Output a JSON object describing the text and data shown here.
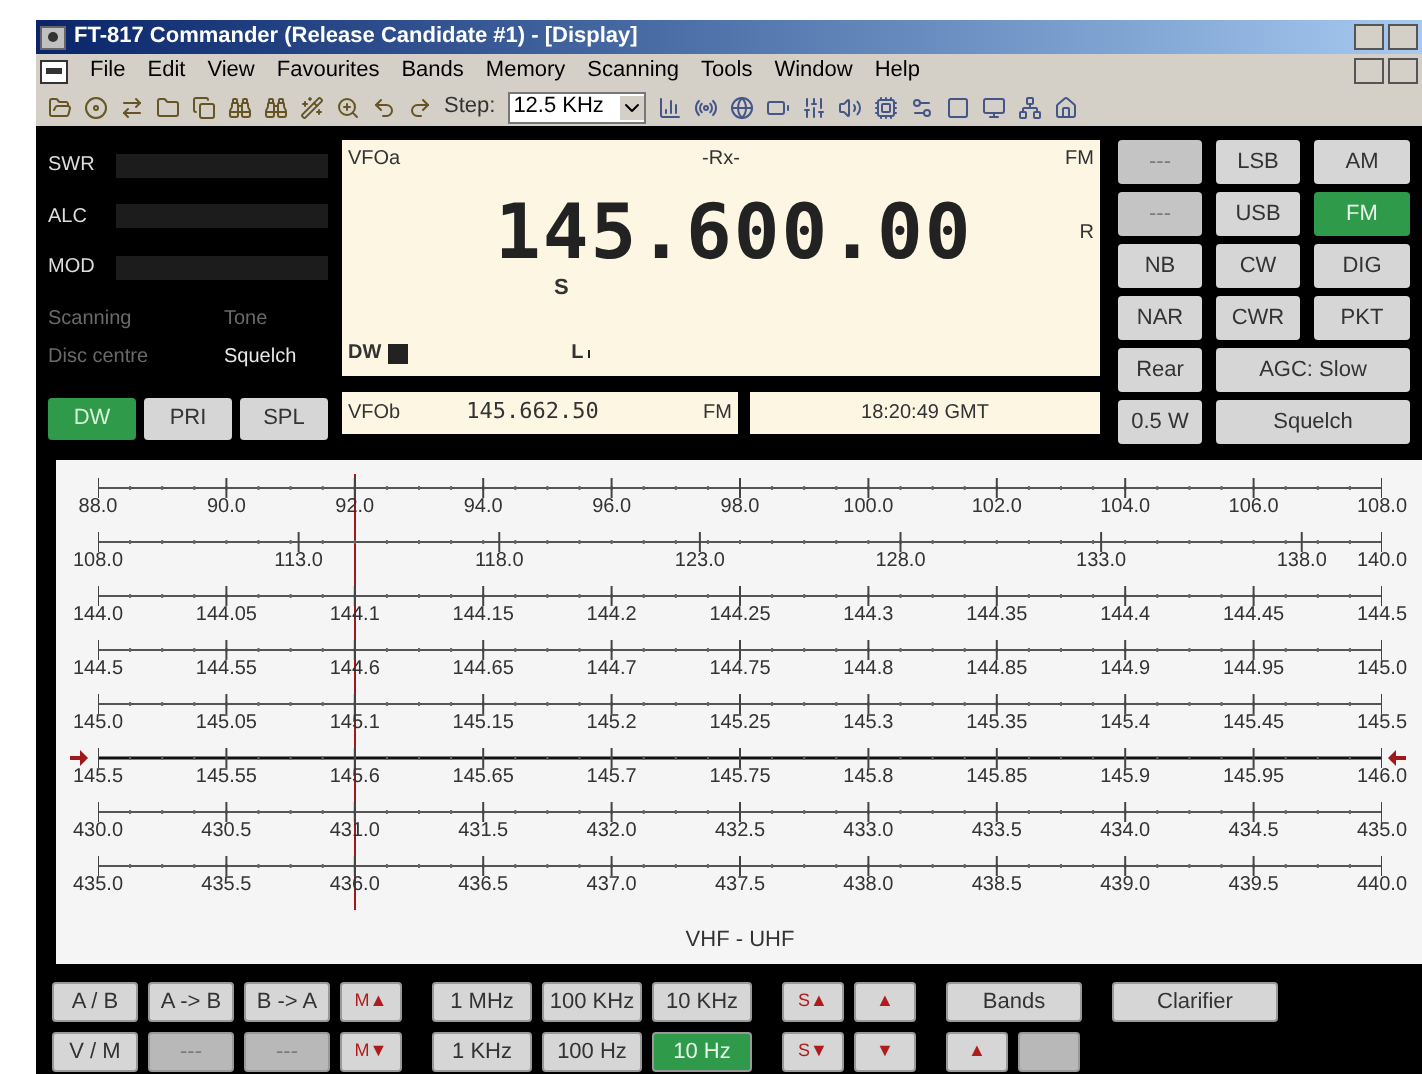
{
  "window": {
    "title": "FT-817 Commander (Release Candidate #1) - [Display]"
  },
  "menu": [
    {
      "label": "File"
    },
    {
      "label": "Edit"
    },
    {
      "label": "View"
    },
    {
      "label": "Favourites"
    },
    {
      "label": "Bands"
    },
    {
      "label": "Memory"
    },
    {
      "label": "Scanning"
    },
    {
      "label": "Tools"
    },
    {
      "label": "Window"
    },
    {
      "label": "Help"
    }
  ],
  "toolbar": {
    "step_label": "Step:",
    "step_value": "12.5 KHz"
  },
  "meters": [
    {
      "label": "SWR",
      "level": 0
    },
    {
      "label": "ALC",
      "level": 0
    },
    {
      "label": "MOD",
      "level": 0
    }
  ],
  "indicators": [
    {
      "label": "Scanning",
      "active": false
    },
    {
      "label": "Tone",
      "active": false
    },
    {
      "label": "Disc centre",
      "active": false
    },
    {
      "label": "Squelch",
      "active": true
    }
  ],
  "left_buttons": [
    {
      "label": "DW",
      "on": true
    },
    {
      "label": "PRI",
      "on": false
    },
    {
      "label": "SPL",
      "on": false
    }
  ],
  "display": {
    "vfo": "VFOa",
    "status": "-Rx-",
    "mode": "FM",
    "frequency": "145.600.00",
    "s_label": "S",
    "r_label": "R",
    "dw_label": "DW",
    "l_label": "L"
  },
  "vfo_b": {
    "name": "VFOb",
    "frequency": "145.662.50",
    "mode": "FM"
  },
  "clock": "18:20:49 GMT",
  "mode_buttons": [
    {
      "label": "---",
      "kind": "normal",
      "on": false,
      "disabled": true
    },
    {
      "label": "LSB",
      "kind": "normal",
      "on": false,
      "disabled": false
    },
    {
      "label": "AM",
      "kind": "normal",
      "on": false,
      "disabled": false
    },
    {
      "label": "---",
      "kind": "normal",
      "on": false,
      "disabled": true
    },
    {
      "label": "USB",
      "kind": "normal",
      "on": false,
      "disabled": false
    },
    {
      "label": "FM",
      "kind": "normal",
      "on": true,
      "disabled": false
    },
    {
      "label": "NB",
      "kind": "normal",
      "on": false,
      "disabled": false
    },
    {
      "label": "CW",
      "kind": "normal",
      "on": false,
      "disabled": false
    },
    {
      "label": "DIG",
      "kind": "normal",
      "on": false,
      "disabled": false
    },
    {
      "label": "NAR",
      "kind": "normal",
      "on": false,
      "disabled": false
    },
    {
      "label": "CWR",
      "kind": "normal",
      "on": false,
      "disabled": false
    },
    {
      "label": "PKT",
      "kind": "normal",
      "on": false,
      "disabled": false
    },
    {
      "label": "Rear",
      "kind": "normal",
      "on": false,
      "disabled": false
    },
    {
      "label": "AGC: Slow",
      "kind": "wide",
      "on": false,
      "disabled": false
    },
    {
      "label": "0.5 W",
      "kind": "normal",
      "on": false,
      "disabled": false
    },
    {
      "label": "Squelch",
      "kind": "wide",
      "on": false,
      "disabled": false
    }
  ],
  "scale": {
    "tuning_cursor": {
      "level": 0.2
    },
    "band": "VHF - UHF",
    "rows": [
      {
        "selected": false,
        "labels": [
          "88.0",
          "90.0",
          "92.0",
          "94.0",
          "96.0",
          "98.0",
          "100.0",
          "102.0",
          "104.0",
          "106.0",
          "108.0"
        ]
      },
      {
        "selected": false,
        "labels": [
          "108.0",
          "113.0",
          "118.0",
          "123.0",
          "128.0",
          "133.0",
          "138.0",
          "140.0"
        ]
      },
      {
        "selected": false,
        "labels": [
          "144.0",
          "144.05",
          "144.1",
          "144.15",
          "144.2",
          "144.25",
          "144.3",
          "144.35",
          "144.4",
          "144.45",
          "144.5"
        ]
      },
      {
        "selected": false,
        "labels": [
          "144.5",
          "144.55",
          "144.6",
          "144.65",
          "144.7",
          "144.75",
          "144.8",
          "144.85",
          "144.9",
          "144.95",
          "145.0"
        ]
      },
      {
        "selected": false,
        "labels": [
          "145.0",
          "145.05",
          "145.1",
          "145.15",
          "145.2",
          "145.25",
          "145.3",
          "145.35",
          "145.4",
          "145.45",
          "145.5"
        ]
      },
      {
        "selected": true,
        "labels": [
          "145.5",
          "145.55",
          "145.6",
          "145.65",
          "145.7",
          "145.75",
          "145.8",
          "145.85",
          "145.9",
          "145.95",
          "146.0"
        ]
      },
      {
        "selected": false,
        "labels": [
          "430.0",
          "430.5",
          "431.0",
          "431.5",
          "432.0",
          "432.5",
          "433.0",
          "433.5",
          "434.0",
          "434.5",
          "435.0"
        ]
      },
      {
        "selected": false,
        "labels": [
          "435.0",
          "435.5",
          "436.0",
          "436.5",
          "437.0",
          "437.5",
          "438.0",
          "438.5",
          "439.0",
          "439.5",
          "440.0"
        ]
      }
    ]
  },
  "bottom_groups": [
    {
      "rows": [
        [
          {
            "label": "A / B",
            "kind": "vfo"
          },
          {
            "label": "A -> B",
            "kind": "vfo"
          },
          {
            "label": "B -> A",
            "kind": "vfo"
          },
          {
            "label": "M▲",
            "kind": "arrow"
          }
        ],
        [
          {
            "label": "V / M",
            "kind": "vfo"
          },
          {
            "label": "---",
            "kind": "vfo",
            "disabled": true
          },
          {
            "label": "---",
            "kind": "vfo",
            "disabled": true
          },
          {
            "label": "M▼",
            "kind": "arrow"
          }
        ]
      ]
    },
    {
      "rows": [
        [
          {
            "label": "1 MHz",
            "kind": "step"
          },
          {
            "label": "100 KHz",
            "kind": "step"
          },
          {
            "label": "10 KHz",
            "kind": "step"
          }
        ],
        [
          {
            "label": "1 KHz",
            "kind": "step"
          },
          {
            "label": "100 Hz",
            "kind": "step"
          },
          {
            "label": "10 Hz",
            "kind": "step",
            "on": true
          }
        ]
      ]
    },
    {
      "rows": [
        [
          {
            "label": "S▲",
            "kind": "arrow"
          },
          {
            "label": "▲",
            "kind": "arrow"
          }
        ],
        [
          {
            "label": "S▼",
            "kind": "arrow"
          },
          {
            "label": "▼",
            "kind": "arrow"
          }
        ]
      ]
    },
    {
      "rows": [
        [
          {
            "label": "Bands",
            "kind": "wide"
          }
        ],
        [
          {
            "label": "▲",
            "kind": "arrow"
          },
          {
            "kind": "arrow",
            "disabled": true
          }
        ]
      ]
    },
    {
      "rows": [
        [
          {
            "label": "Clarifier",
            "kind": "xwide"
          }
        ]
      ]
    }
  ]
}
